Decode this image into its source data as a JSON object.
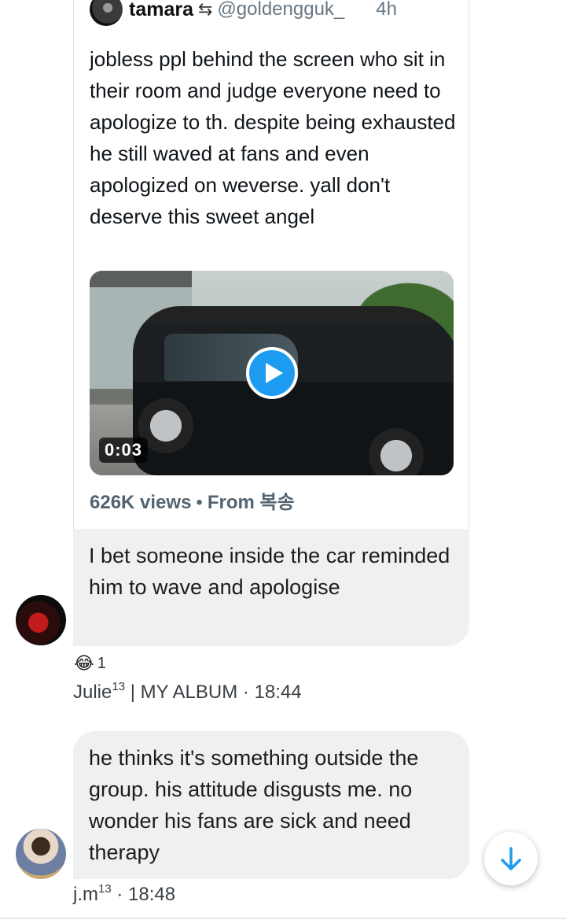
{
  "tweet": {
    "name": "tamara",
    "swap_symbol": "⇆",
    "handle": "@goldengguk_",
    "time": "4h",
    "text": "jobless ppl behind the screen who sit in their room and judge everyone need to apologize to th. despite being exhausted he still waved at fans and even apologized on weverse. yall don't deserve this sweet angel",
    "video_duration": "0:03",
    "views": "626K views",
    "separator": "•",
    "from": "From 복송"
  },
  "messages": [
    {
      "text": "I bet someone inside the car reminded him to wave and apologise",
      "reaction": {
        "emoji": "😂",
        "count": "1"
      },
      "sender_name": "Julie",
      "sender_sup": "13",
      "sender_rest": " | MY ALBUM · 18:44"
    },
    {
      "text": "he thinks it's something outside the group. his attitude disgusts me. no wonder his fans are sick and need therapy",
      "sender_name": "j.m",
      "sender_sup": "13",
      "sender_rest": " · 18:48"
    }
  ],
  "colors": {
    "accent": "#1d9bf0",
    "bubble": "#eef0f2",
    "meta_text": "#536471"
  },
  "icons": {
    "play": "play-icon",
    "scroll_down": "arrow-down-icon",
    "swap": "swap-arrows-icon"
  }
}
